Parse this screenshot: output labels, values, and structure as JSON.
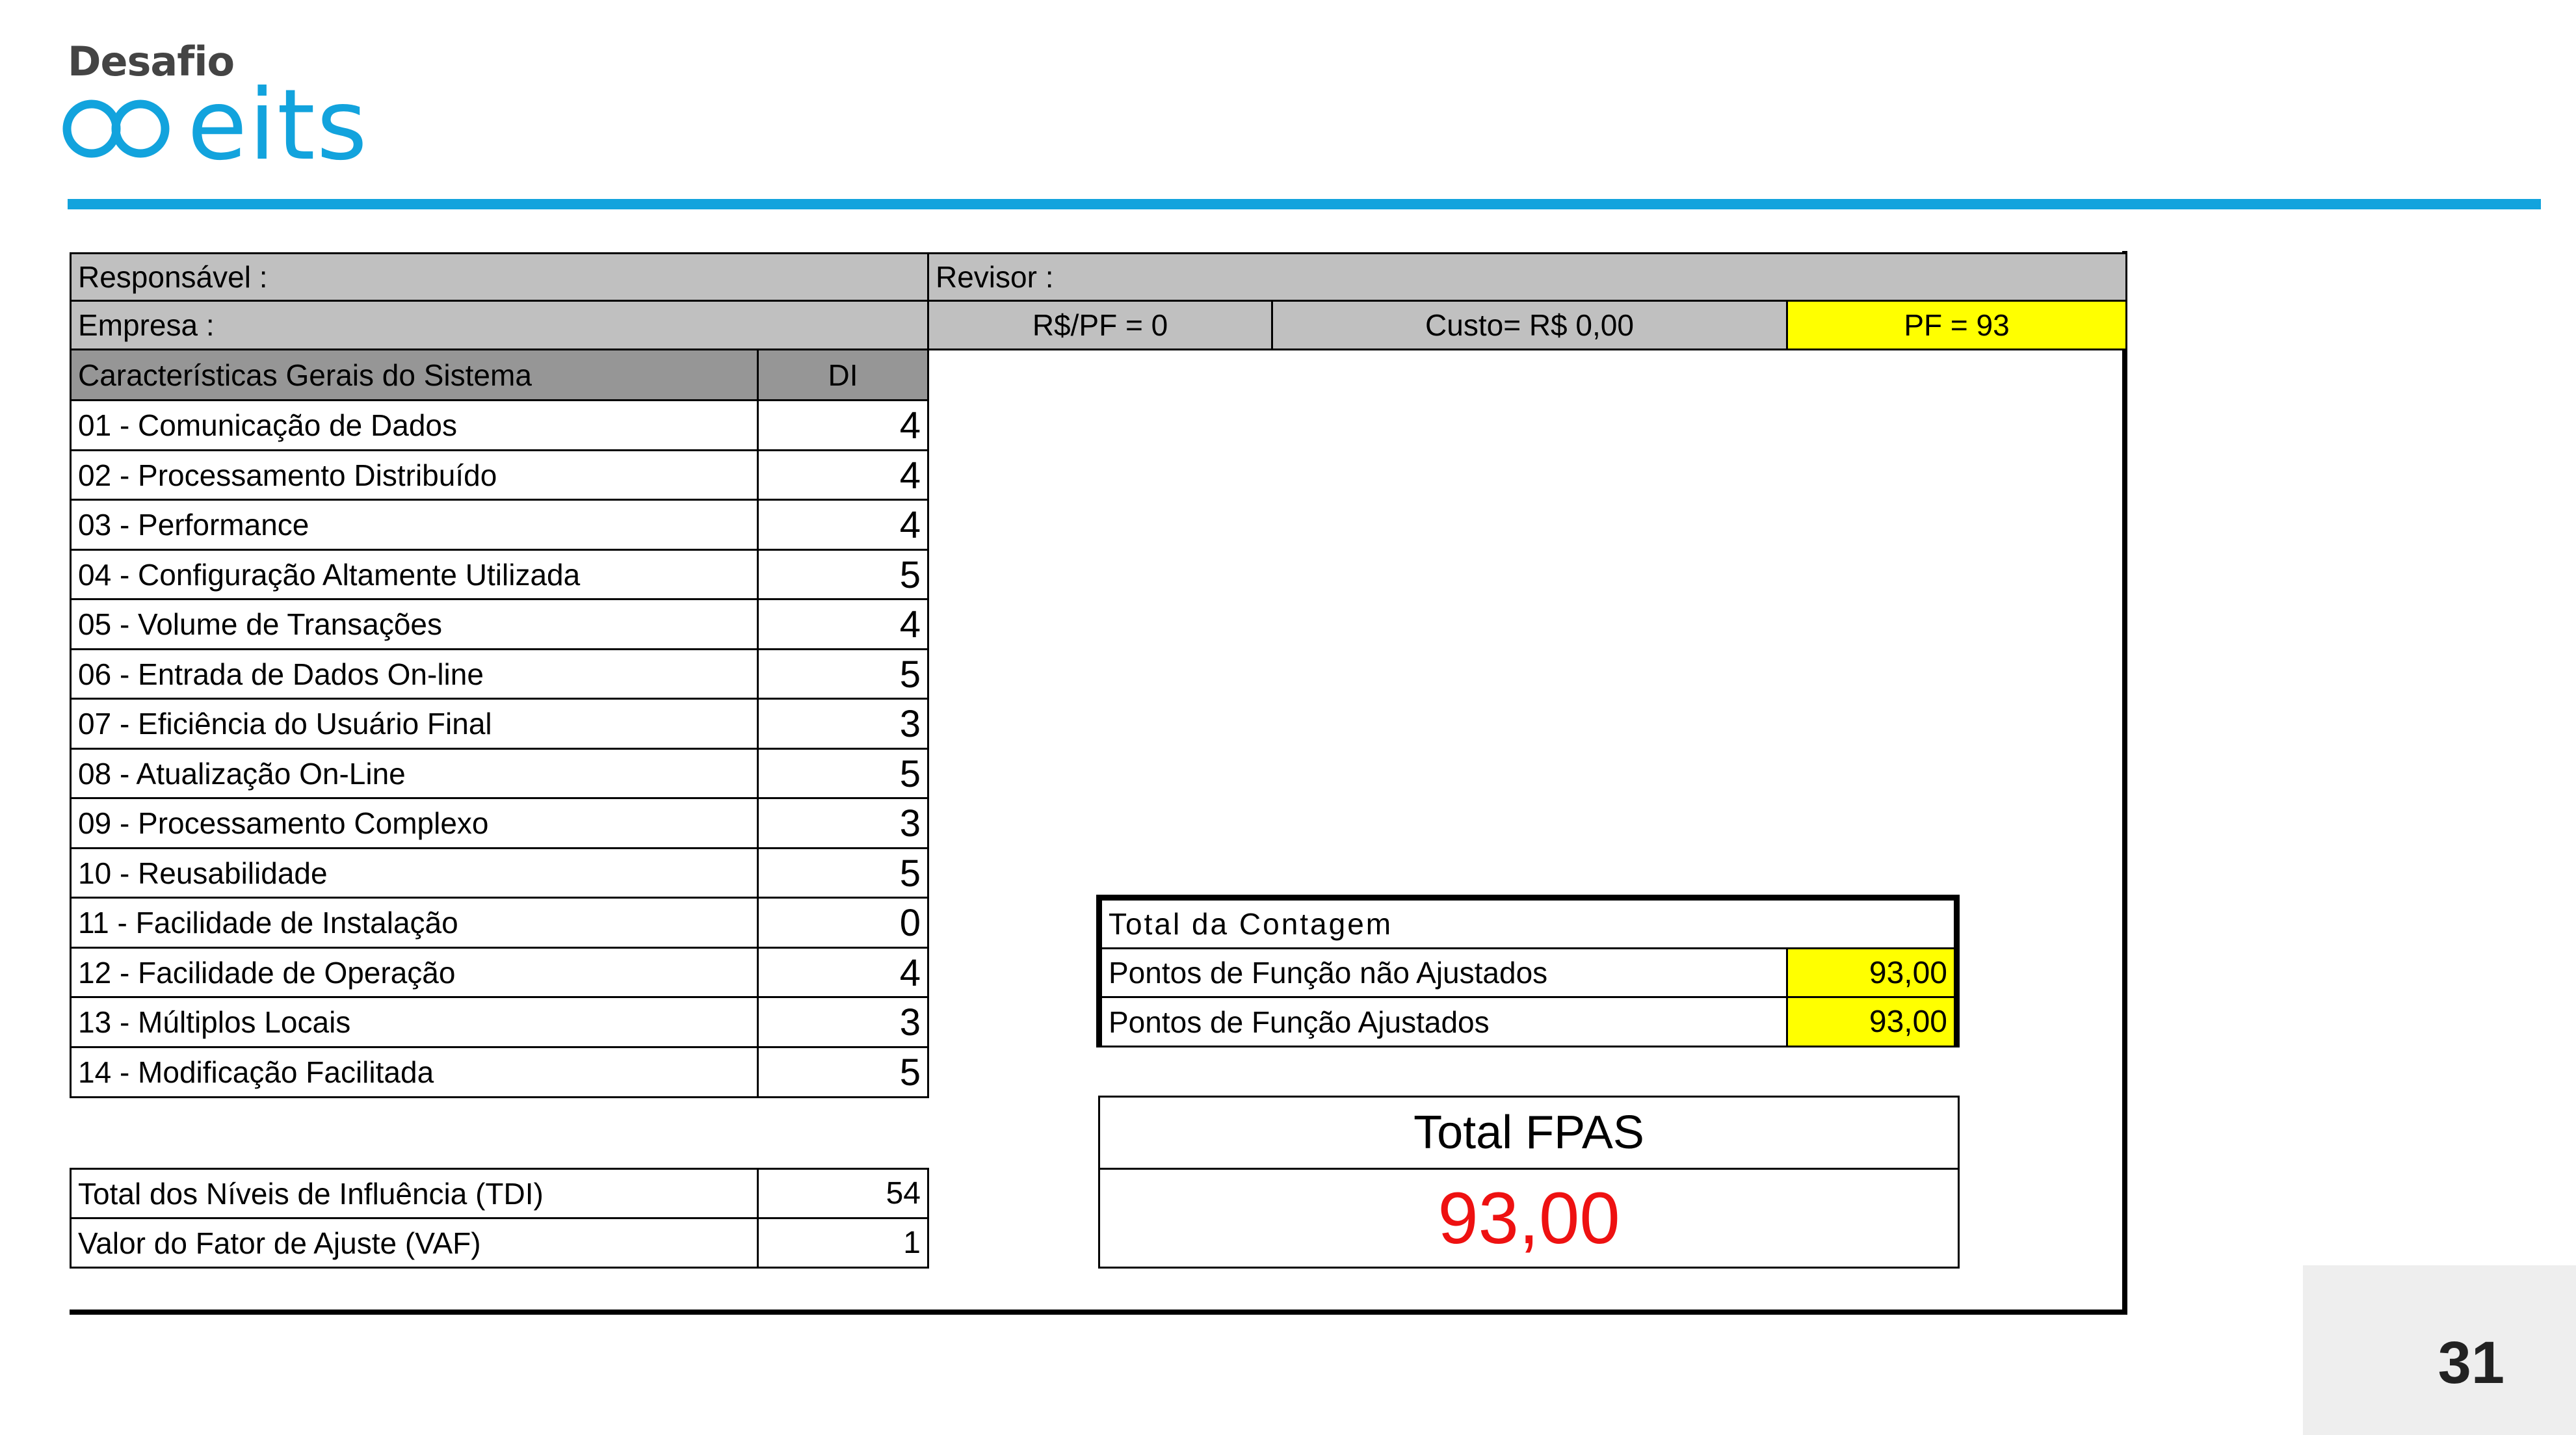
{
  "logo": {
    "top_text": "Desafio",
    "brand_text": "eits"
  },
  "header": {
    "responsavel": "Responsável :",
    "revisor": "Revisor :",
    "empresa": "Empresa :",
    "rs_pf": "R$/PF = 0",
    "custo": "Custo= R$ 0,00",
    "pf": "PF  = 93"
  },
  "gsc": {
    "col_header": "Características Gerais do Sistema",
    "di_header": "DI",
    "items": [
      {
        "label": "01 - Comunicação de Dados",
        "value": "4"
      },
      {
        "label": "02 - Processamento Distribuído",
        "value": "4"
      },
      {
        "label": "03 - Performance",
        "value": "4"
      },
      {
        "label": "04 - Configuração Altamente Utilizada",
        "value": "5"
      },
      {
        "label": "05 - Volume de Transações",
        "value": "4"
      },
      {
        "label": "06 - Entrada de Dados On-line",
        "value": "5"
      },
      {
        "label": "07 - Eficiência do Usuário Final",
        "value": "3"
      },
      {
        "label": "08 - Atualização On-Line",
        "value": "5"
      },
      {
        "label": "09 - Processamento Complexo",
        "value": "3"
      },
      {
        "label": "10 - Reusabilidade",
        "value": "5"
      },
      {
        "label": "11 - Facilidade de Instalação",
        "value": "0"
      },
      {
        "label": "12 - Facilidade de Operação",
        "value": "4"
      },
      {
        "label": "13 - Múltiplos Locais",
        "value": "3"
      },
      {
        "label": "14 - Modificação Facilitada",
        "value": "5"
      }
    ]
  },
  "summary": {
    "tdi_label": "Total dos Níveis de Influência (TDI)",
    "tdi_value": "54",
    "vaf_label": "Valor do Fator de Ajuste (VAF)",
    "vaf_value": "1"
  },
  "contagem": {
    "title": "Total da Contagem",
    "nao_ajustados_label": "Pontos de Função não Ajustados",
    "nao_ajustados_value": "93,00",
    "ajustados_label": "Pontos de Função Ajustados",
    "ajustados_value": "93,00"
  },
  "fpas": {
    "title": "Total FPAS",
    "value": "93,00"
  },
  "page_number": "31",
  "colors": {
    "brand_blue": "#12a3dd",
    "highlight_yellow": "#ffff00",
    "header_gray": "#c0c0c0",
    "value_red": "#ee1111"
  }
}
